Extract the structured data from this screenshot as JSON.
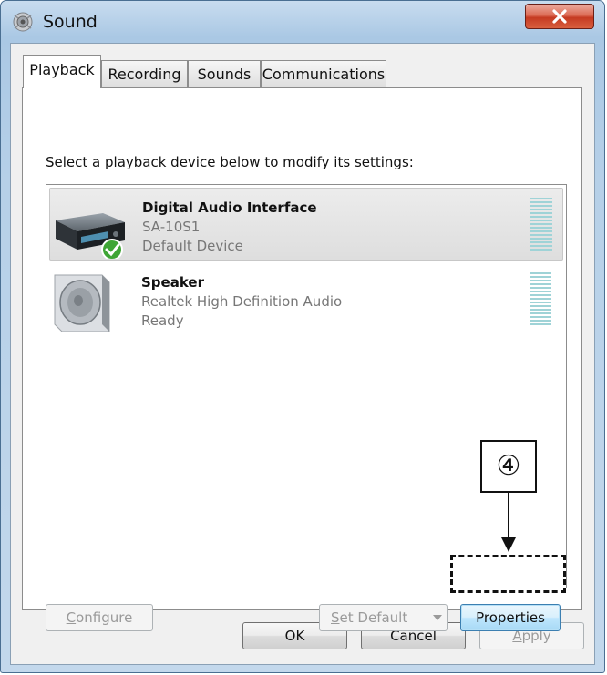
{
  "window": {
    "title": "Sound"
  },
  "tabs": [
    {
      "label": "Playback",
      "active": true
    },
    {
      "label": "Recording",
      "active": false
    },
    {
      "label": "Sounds",
      "active": false
    },
    {
      "label": "Communications",
      "active": false
    }
  ],
  "playback": {
    "instruction": "Select a playback device below to modify its settings:",
    "devices": [
      {
        "name": "Digital Audio Interface",
        "description": "SA-10S1",
        "status": "Default Device",
        "selected": true,
        "icon": "audio-interface-icon",
        "default_badge": "check-badge-icon"
      },
      {
        "name": "Speaker",
        "description": "Realtek High Definition Audio",
        "status": "Ready",
        "selected": false,
        "icon": "speaker-icon"
      }
    ],
    "configure": {
      "accel": "C",
      "rest": "onfigure",
      "enabled": false
    },
    "set_default": {
      "accel": "S",
      "rest": "et Default",
      "enabled": false
    },
    "properties": {
      "label": "Properties",
      "enabled": true,
      "focused": true
    }
  },
  "callout": {
    "label": "④"
  },
  "dialog_buttons": {
    "ok": "OK",
    "cancel": "Cancel",
    "apply": {
      "accel": "A",
      "rest": "pply",
      "enabled": false
    }
  },
  "colors": {
    "selection": "#e4e4e4",
    "meter": "#9fd3d7",
    "close": "#c53a22",
    "frame": "#aac8e4"
  }
}
